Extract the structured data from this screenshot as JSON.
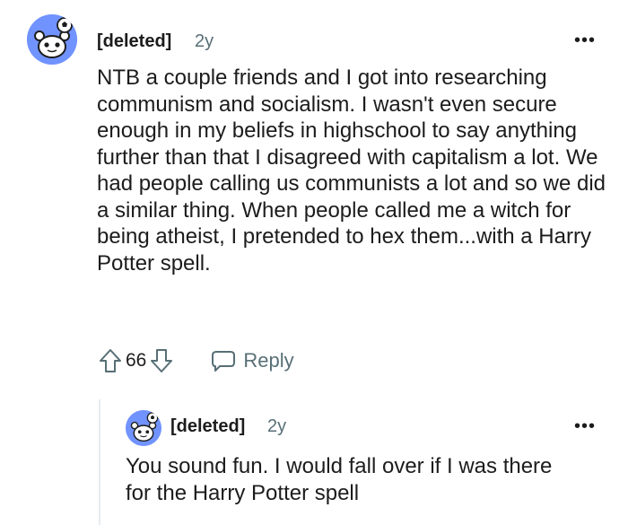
{
  "comments": [
    {
      "author": "[deleted]",
      "age": "2y",
      "more_label": "•••",
      "avatar_icon": "reddit-snoo-soccer-icon",
      "body": "NTB a couple friends and I got into researching communism and socialism. I wasn't even secure enough in my beliefs in highschool to say anything further than that I disagreed with capitalism a lot. We had people calling us communists a lot and so we did a similar thing. When people called me a witch for being atheist, I pretended to hex them...with a Harry Potter spell.",
      "score": "66",
      "reply_label": "Reply"
    },
    {
      "author": "[deleted]",
      "age": "2y",
      "more_label": "•••",
      "avatar_icon": "reddit-snoo-soccer-icon",
      "body": "You sound fun. I would fall over if I was there for the Harry Potter spell"
    }
  ],
  "colors": {
    "avatar_bg": "#7193ff",
    "meta_gray": "#576f76",
    "text": "#1c1c1c"
  }
}
